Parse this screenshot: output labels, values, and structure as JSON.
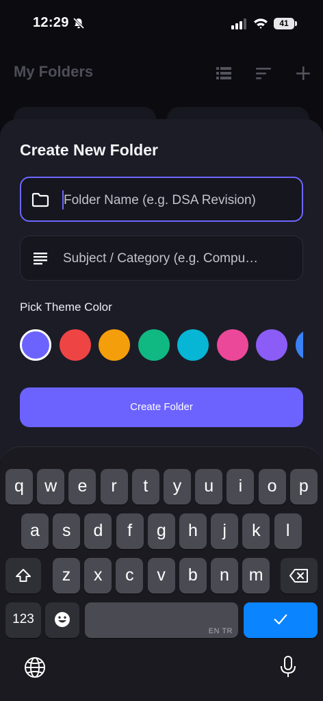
{
  "status_bar": {
    "time": "12:29",
    "battery": "41"
  },
  "header": {
    "title": "My Folders"
  },
  "sheet": {
    "title": "Create New Folder",
    "folder_name_placeholder": "Folder Name (e.g. DSA Revision)",
    "subject_placeholder": "Subject / Category (e.g. Compu…",
    "theme_label": "Pick Theme Color",
    "colors": [
      "#6c63ff",
      "#ef4444",
      "#f59e0b",
      "#10b981",
      "#06b6d4",
      "#ec4899",
      "#8b5cf6",
      "#3b82f6"
    ],
    "selected_color_index": 0,
    "create_button": "Create Folder"
  },
  "keyboard": {
    "row1": [
      "q",
      "w",
      "e",
      "r",
      "t",
      "y",
      "u",
      "i",
      "o",
      "p"
    ],
    "row2": [
      "a",
      "s",
      "d",
      "f",
      "g",
      "h",
      "j",
      "k",
      "l"
    ],
    "row3": [
      "z",
      "x",
      "c",
      "v",
      "b",
      "n",
      "m"
    ],
    "numbers_key": "123",
    "space_hint": "EN TR"
  }
}
